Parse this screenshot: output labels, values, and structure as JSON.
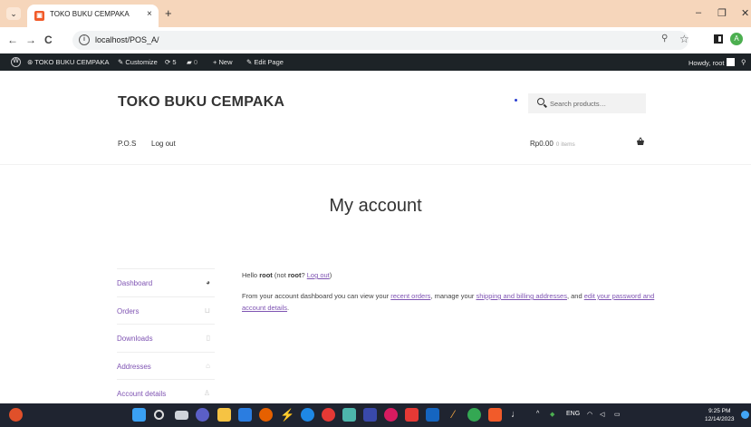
{
  "browser": {
    "tab_title": "TOKO BUKU CEMPAKA",
    "tab_close": "×",
    "new_tab": "+",
    "url": "localhost/POS_A/",
    "profile_initial": "A"
  },
  "admin_bar": {
    "site_name": "TOKO BUKU CEMPAKA",
    "customize": "Customize",
    "updates_count": "5",
    "comments_count": "0",
    "new": "New",
    "edit_page": "Edit Page",
    "howdy": "Howdy, root"
  },
  "site": {
    "title": "TOKO BUKU CEMPAKA",
    "search_placeholder": "Search products…",
    "nav": [
      "P.O.S",
      "Log out"
    ],
    "cart_amount": "Rp0.00",
    "cart_items": "0 items"
  },
  "page": {
    "title": "My account"
  },
  "account_nav": [
    {
      "label": "Dashboard",
      "icon": "dashboard-icon"
    },
    {
      "label": "Orders",
      "icon": "basket-icon"
    },
    {
      "label": "Downloads",
      "icon": "file-icon"
    },
    {
      "label": "Addresses",
      "icon": "home-icon"
    },
    {
      "label": "Account details",
      "icon": "user-icon"
    }
  ],
  "content": {
    "hello_prefix": "Hello ",
    "user": "root",
    "not_prefix": " (not ",
    "not_user": "root",
    "not_suffix": "? ",
    "logout_link": "Log out",
    "close_paren": ")",
    "dash_text_1": "From your account dashboard you can view your ",
    "recent_orders": "recent orders",
    "dash_text_2": ", manage your ",
    "shipping": "shipping and billing addresses",
    "dash_text_3": ", and ",
    "edit_account": "edit your password and account details",
    "dash_text_4": "."
  },
  "taskbar": {
    "lang": "ENG",
    "time": "9:25 PM",
    "date": "12/14/2023"
  },
  "colors": {
    "accent": "#7f54b3",
    "admin_bar": "#1d2327",
    "tab_strip": "#f6d6bb",
    "taskbar": "#1f2430"
  }
}
